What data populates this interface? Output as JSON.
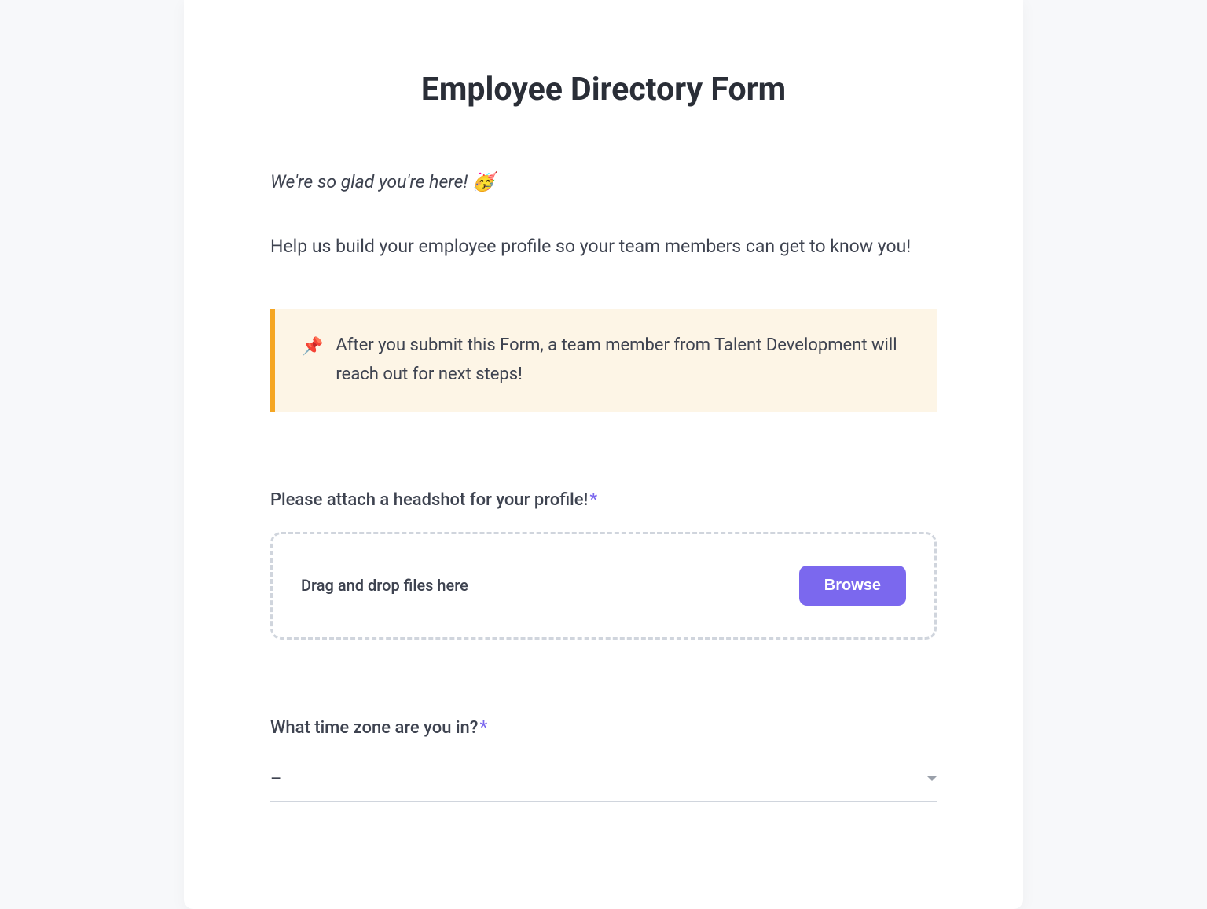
{
  "form": {
    "title": "Employee Directory Form",
    "intro_welcome": "We're so glad you're here! 🥳",
    "intro_description": "Help us build your employee profile so your team members can get to know you!",
    "notice": {
      "icon": "📌",
      "text": "After you submit this Form, a team member from Talent Development will reach out for next steps!"
    },
    "fields": {
      "headshot": {
        "label": "Please attach a headshot for your profile!",
        "required_marker": "*",
        "dropzone_text": "Drag and drop files here",
        "browse_label": "Browse"
      },
      "timezone": {
        "label": "What time zone are you in?",
        "required_marker": "*",
        "value": "–"
      }
    }
  }
}
